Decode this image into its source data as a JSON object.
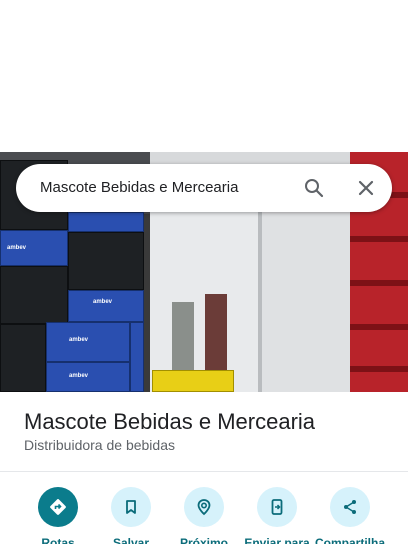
{
  "search": {
    "query": "Mascote Bebidas e Mercearia"
  },
  "photo": {
    "crate_brand": "ambev"
  },
  "place": {
    "title": "Mascote Bebidas e Mercearia",
    "category": "Distribuidora de bebidas"
  },
  "actions": [
    {
      "label": "Rotas",
      "icon": "directions-icon"
    },
    {
      "label": "Salvar",
      "icon": "bookmark-icon"
    },
    {
      "label": "Próximo",
      "icon": "nearby-icon"
    },
    {
      "label": "Enviar para",
      "icon": "send-to-phone-icon"
    },
    {
      "label": "Compartilha",
      "icon": "share-icon"
    }
  ],
  "colors": {
    "accent": "#0b7c8c",
    "action_bg": "#d6f2fb",
    "action_text": "#0b6c7a"
  }
}
